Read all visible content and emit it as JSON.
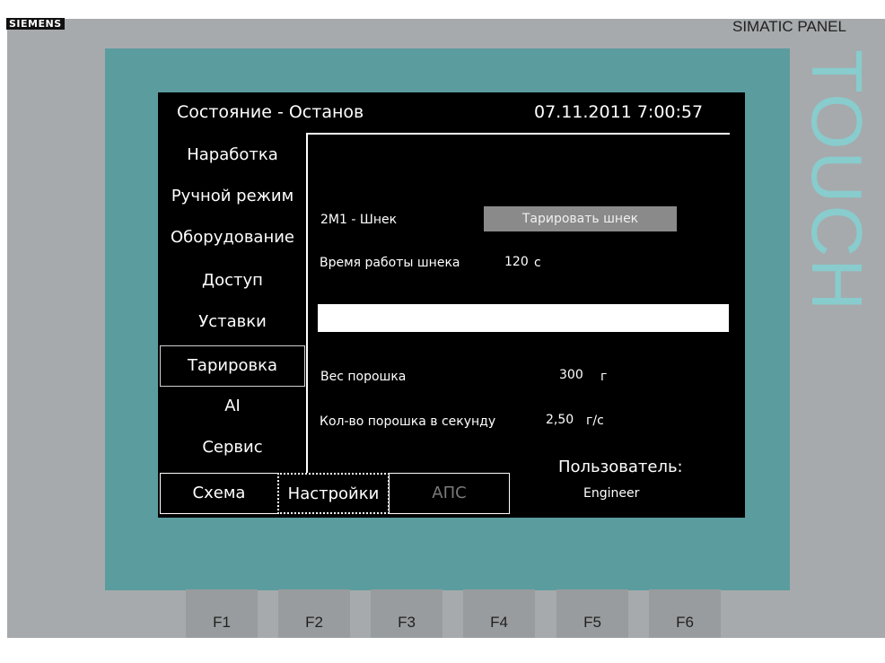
{
  "device": {
    "brand": "SIEMENS",
    "model": "SIMATIC PANEL",
    "touch_label": "TOUCH"
  },
  "header": {
    "status_label": "Состояние - Останов",
    "datetime": "07.11.2011 7:00:57"
  },
  "nav": {
    "items": [
      {
        "label": "Наработка"
      },
      {
        "label": "Ручной режим"
      },
      {
        "label": "Оборудование"
      },
      {
        "label": "Доступ"
      },
      {
        "label": "Уставки"
      },
      {
        "label": "Тарировка",
        "active": true
      },
      {
        "label": "AI"
      },
      {
        "label": "Сервис"
      }
    ]
  },
  "content": {
    "screw_label": "2М1 - Шнек",
    "tare_button": "Тарировать шнек",
    "runtime_label": "Время работы шнека",
    "runtime_value": "120",
    "runtime_unit": "с",
    "powder_weight_label": "Вес порошка",
    "powder_weight_value": "300",
    "powder_weight_unit": "г",
    "powder_rate_label": "Кол-во порошка в секунду",
    "powder_rate_value": "2,50",
    "powder_rate_unit": "г/с",
    "user_label": "Пользователь:",
    "user_value": "Engineer"
  },
  "tabs": [
    {
      "label": "Схема"
    },
    {
      "label": "Настройки",
      "focused": true
    },
    {
      "label": "АПС",
      "disabled": true
    }
  ],
  "function_keys": [
    "F1",
    "F2",
    "F3",
    "F4",
    "F5",
    "F6"
  ],
  "colors": {
    "bezel": "#a6aaac",
    "panel": "#5b9c9f",
    "screen": "#000000",
    "button": "#8a8a8a",
    "touch_text": "#88cccd"
  }
}
